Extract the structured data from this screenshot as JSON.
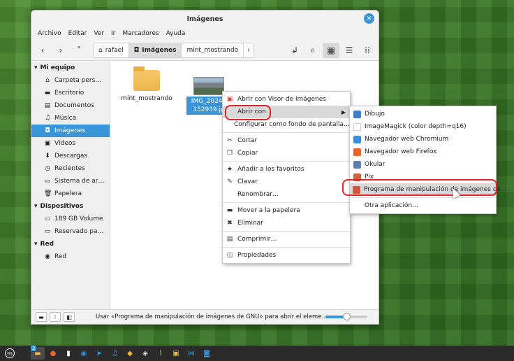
{
  "window": {
    "title": "Imágenes"
  },
  "menubar": [
    "Archivo",
    "Editar",
    "Ver",
    "Ir",
    "Marcadores",
    "Ayuda"
  ],
  "breadcrumbs": [
    {
      "label": "rafael",
      "icon": "home-icon"
    },
    {
      "label": "Imágenes",
      "icon": "camera-icon",
      "current": true
    },
    {
      "label": "mint_mostrando",
      "icon": ""
    }
  ],
  "sidebar": {
    "sections": [
      {
        "title": "Mi equipo",
        "items": [
          {
            "label": "Carpeta pers…",
            "icon": "home-icon"
          },
          {
            "label": "Escritorio",
            "icon": "desktop-icon"
          },
          {
            "label": "Documentos",
            "icon": "document-icon"
          },
          {
            "label": "Música",
            "icon": "music-icon"
          },
          {
            "label": "Imágenes",
            "icon": "camera-icon",
            "selected": true
          },
          {
            "label": "Vídeos",
            "icon": "video-icon"
          },
          {
            "label": "Descargas",
            "icon": "download-icon"
          },
          {
            "label": "Recientes",
            "icon": "clock-icon"
          },
          {
            "label": "Sistema de ar…",
            "icon": "drive-icon"
          },
          {
            "label": "Papelera",
            "icon": "trash-icon"
          }
        ]
      },
      {
        "title": "Dispositivos",
        "items": [
          {
            "label": "189 GB Volume",
            "icon": "drive-icon"
          },
          {
            "label": "Reservado pa…",
            "icon": "drive-icon"
          }
        ]
      },
      {
        "title": "Red",
        "items": [
          {
            "label": "Red",
            "icon": "network-icon"
          }
        ]
      }
    ]
  },
  "files": [
    {
      "name": "mint_mostrando",
      "type": "folder"
    },
    {
      "name_line1": "IMG_20240",
      "name_line2": "152939.jp",
      "type": "image",
      "selected": true
    }
  ],
  "context_menu": {
    "items": [
      {
        "label": "Abrir con Visor de imágenes",
        "icon": "image-viewer-icon"
      },
      {
        "label": "Abrir con",
        "submenu": true,
        "highlighted": true
      },
      {
        "label": "Configurar como fondo de pantalla…"
      },
      {
        "separator": true
      },
      {
        "label": "Cortar",
        "icon": "scissors-icon"
      },
      {
        "label": "Copiar",
        "icon": "copy-icon"
      },
      {
        "separator": true
      },
      {
        "label": "Añadir a los favoritos",
        "icon": "star-icon"
      },
      {
        "label": "Clavar",
        "icon": "pin-icon"
      },
      {
        "label": "Renombrar…"
      },
      {
        "separator": true
      },
      {
        "label": "Mover a la papelera",
        "icon": "trash-icon"
      },
      {
        "label": "Eliminar",
        "icon": "delete-icon"
      },
      {
        "separator": true
      },
      {
        "label": "Comprimir…",
        "icon": "archive-icon"
      },
      {
        "separator": true
      },
      {
        "label": "Propiedades",
        "icon": "properties-icon"
      }
    ]
  },
  "submenu": {
    "items": [
      {
        "label": "Dibujo",
        "color": "#3f7fc7"
      },
      {
        "label": "ImageMagick (color depth=q16)",
        "color": "#ffffff"
      },
      {
        "label": "Navegador web Chromium",
        "color": "#3b8ee0"
      },
      {
        "label": "Navegador web Firefox",
        "color": "#e8642a"
      },
      {
        "label": "Okular",
        "color": "#5a7fb0"
      },
      {
        "label": "Pix",
        "color": "#c4673f"
      },
      {
        "label": "Programa de manipulación de imágenes de …",
        "color": "#d0573b",
        "highlighted": true
      },
      {
        "separator": true
      },
      {
        "label": "Otra aplicación…"
      }
    ]
  },
  "status": {
    "text": "Usar «Programa de manipulación de imágenes de GNU» para abrir el eleme…",
    "zoom_fraction": 0.5
  },
  "colors": {
    "accent": "#3a95d8",
    "highlight_ring": "#e0262a"
  },
  "taskbar": {
    "workspace_badge": "2"
  }
}
